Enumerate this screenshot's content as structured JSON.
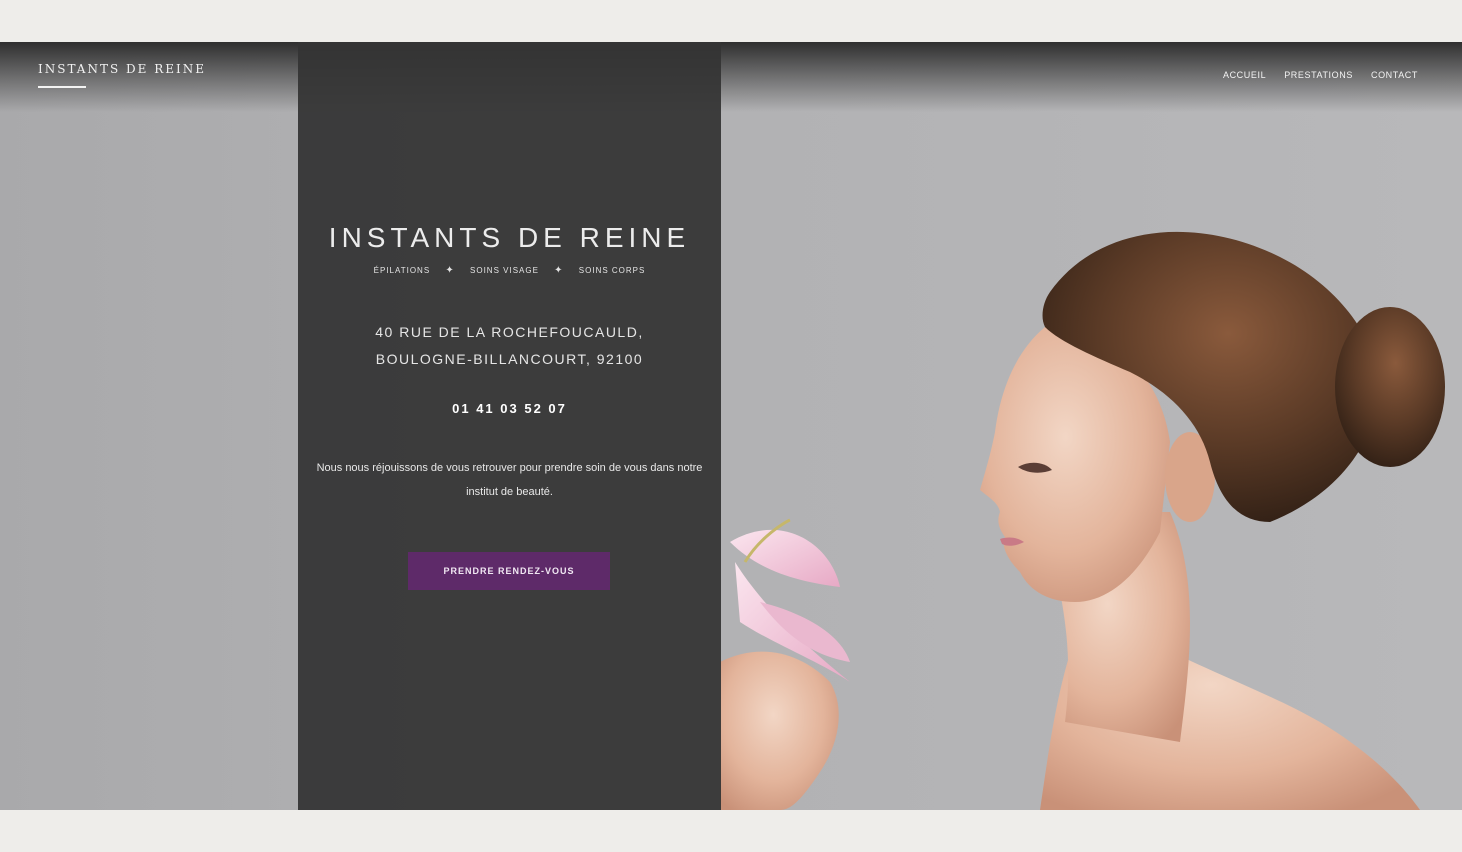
{
  "header": {
    "brand": "INSTANTS DE REINE",
    "nav": [
      "ACCUEIL",
      "PRESTATIONS",
      "CONTACT"
    ]
  },
  "hero": {
    "title": "INSTANTS DE REINE",
    "services": [
      "ÉPILATIONS",
      "SOINS VISAGE",
      "SOINS CORPS"
    ],
    "address_line1": "40 RUE DE LA ROCHEFOUCAULD,",
    "address_line2": "BOULOGNE-BILLANCOURT, 92100",
    "phone": "01 41 03 52 07",
    "intro": "Nous nous réjouissons de vous retrouver pour prendre soin de vous dans notre institut de beauté.",
    "cta_label": "PRENDRE RENDEZ-VOUS"
  },
  "colors": {
    "panel": "#343434",
    "accent": "#5e2a69",
    "page_bg": "#eeedea"
  },
  "icons": [
    "star-separator-icon"
  ]
}
